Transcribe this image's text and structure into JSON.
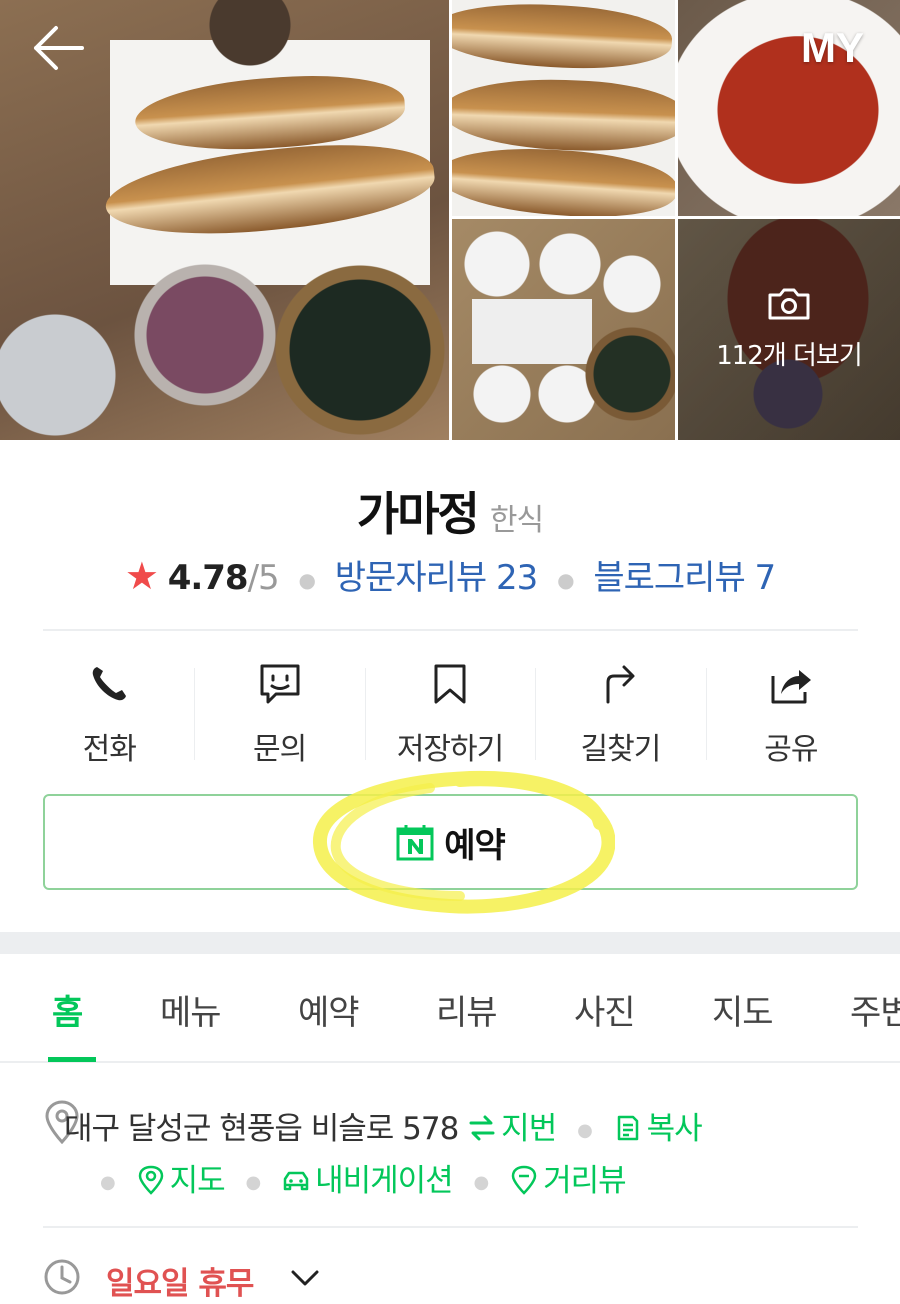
{
  "header": {
    "back_icon": "arrow-left-icon",
    "my_label": "MY"
  },
  "gallery": {
    "more_label": "112개 더보기",
    "camera_icon": "camera-icon"
  },
  "place": {
    "name": "가마정",
    "category": "한식",
    "rating": "4.78",
    "rating_max": "/5",
    "visitor_reviews": "방문자리뷰 23",
    "blog_reviews": "블로그리뷰 7"
  },
  "actions": [
    {
      "label": "전화",
      "icon": "phone-icon"
    },
    {
      "label": "문의",
      "icon": "chat-icon"
    },
    {
      "label": "저장하기",
      "icon": "bookmark-icon"
    },
    {
      "label": "길찾기",
      "icon": "directions-icon"
    },
    {
      "label": "공유",
      "icon": "share-icon"
    }
  ],
  "reserve": {
    "label": "예약",
    "icon": "naver-calendar-icon"
  },
  "tabs": [
    "홈",
    "메뉴",
    "예약",
    "리뷰",
    "사진",
    "지도",
    "주변"
  ],
  "active_tab": "홈",
  "info": {
    "address": "대구 달성군 현풍읍 비슬로 578",
    "jibeon_label": "지번",
    "copy_label": "복사",
    "map_label": "지도",
    "navigation_label": "내비게이션",
    "streetview_label": "거리뷰",
    "hours_status": "일요일 휴무"
  },
  "colors": {
    "brand_green": "#03c75a",
    "link_blue": "#2e64b4",
    "star_red": "#f04b4b",
    "closed_red": "#e05252"
  }
}
